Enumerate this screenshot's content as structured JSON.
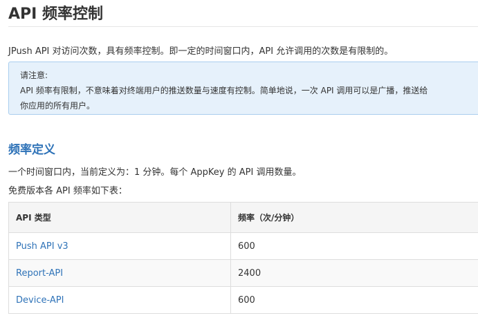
{
  "page": {
    "title": "API 频率控制",
    "intro": "JPush API 对访问次数，具有频率控制。即一定的时间窗口内，API 允许调用的次数是有限制的。"
  },
  "note": {
    "heading": "请注意:",
    "line1": "API 频率有限制，不意味着对终端用户的推送数量与速度有控制。简单地说，一次 API 调用可以是广播，推送给",
    "line2": "你应用的所有用户。"
  },
  "section": {
    "heading": "频率定义",
    "line1": "一个时间窗口内，当前定义为：1 分钟。每个 AppKey 的 API 调用数量。",
    "line2": "免费版本各 API 频率如下表："
  },
  "table": {
    "headers": [
      "API 类型",
      "频率（次/分钟）"
    ],
    "rows": [
      {
        "api": "Push API v3",
        "rate": "600"
      },
      {
        "api": "Report-API",
        "rate": "2400"
      },
      {
        "api": "Device-API",
        "rate": "600"
      }
    ]
  },
  "colors": {
    "link": "#2f73b8",
    "note_bg": "#e6f1fb",
    "note_border": "#a9cdee"
  }
}
